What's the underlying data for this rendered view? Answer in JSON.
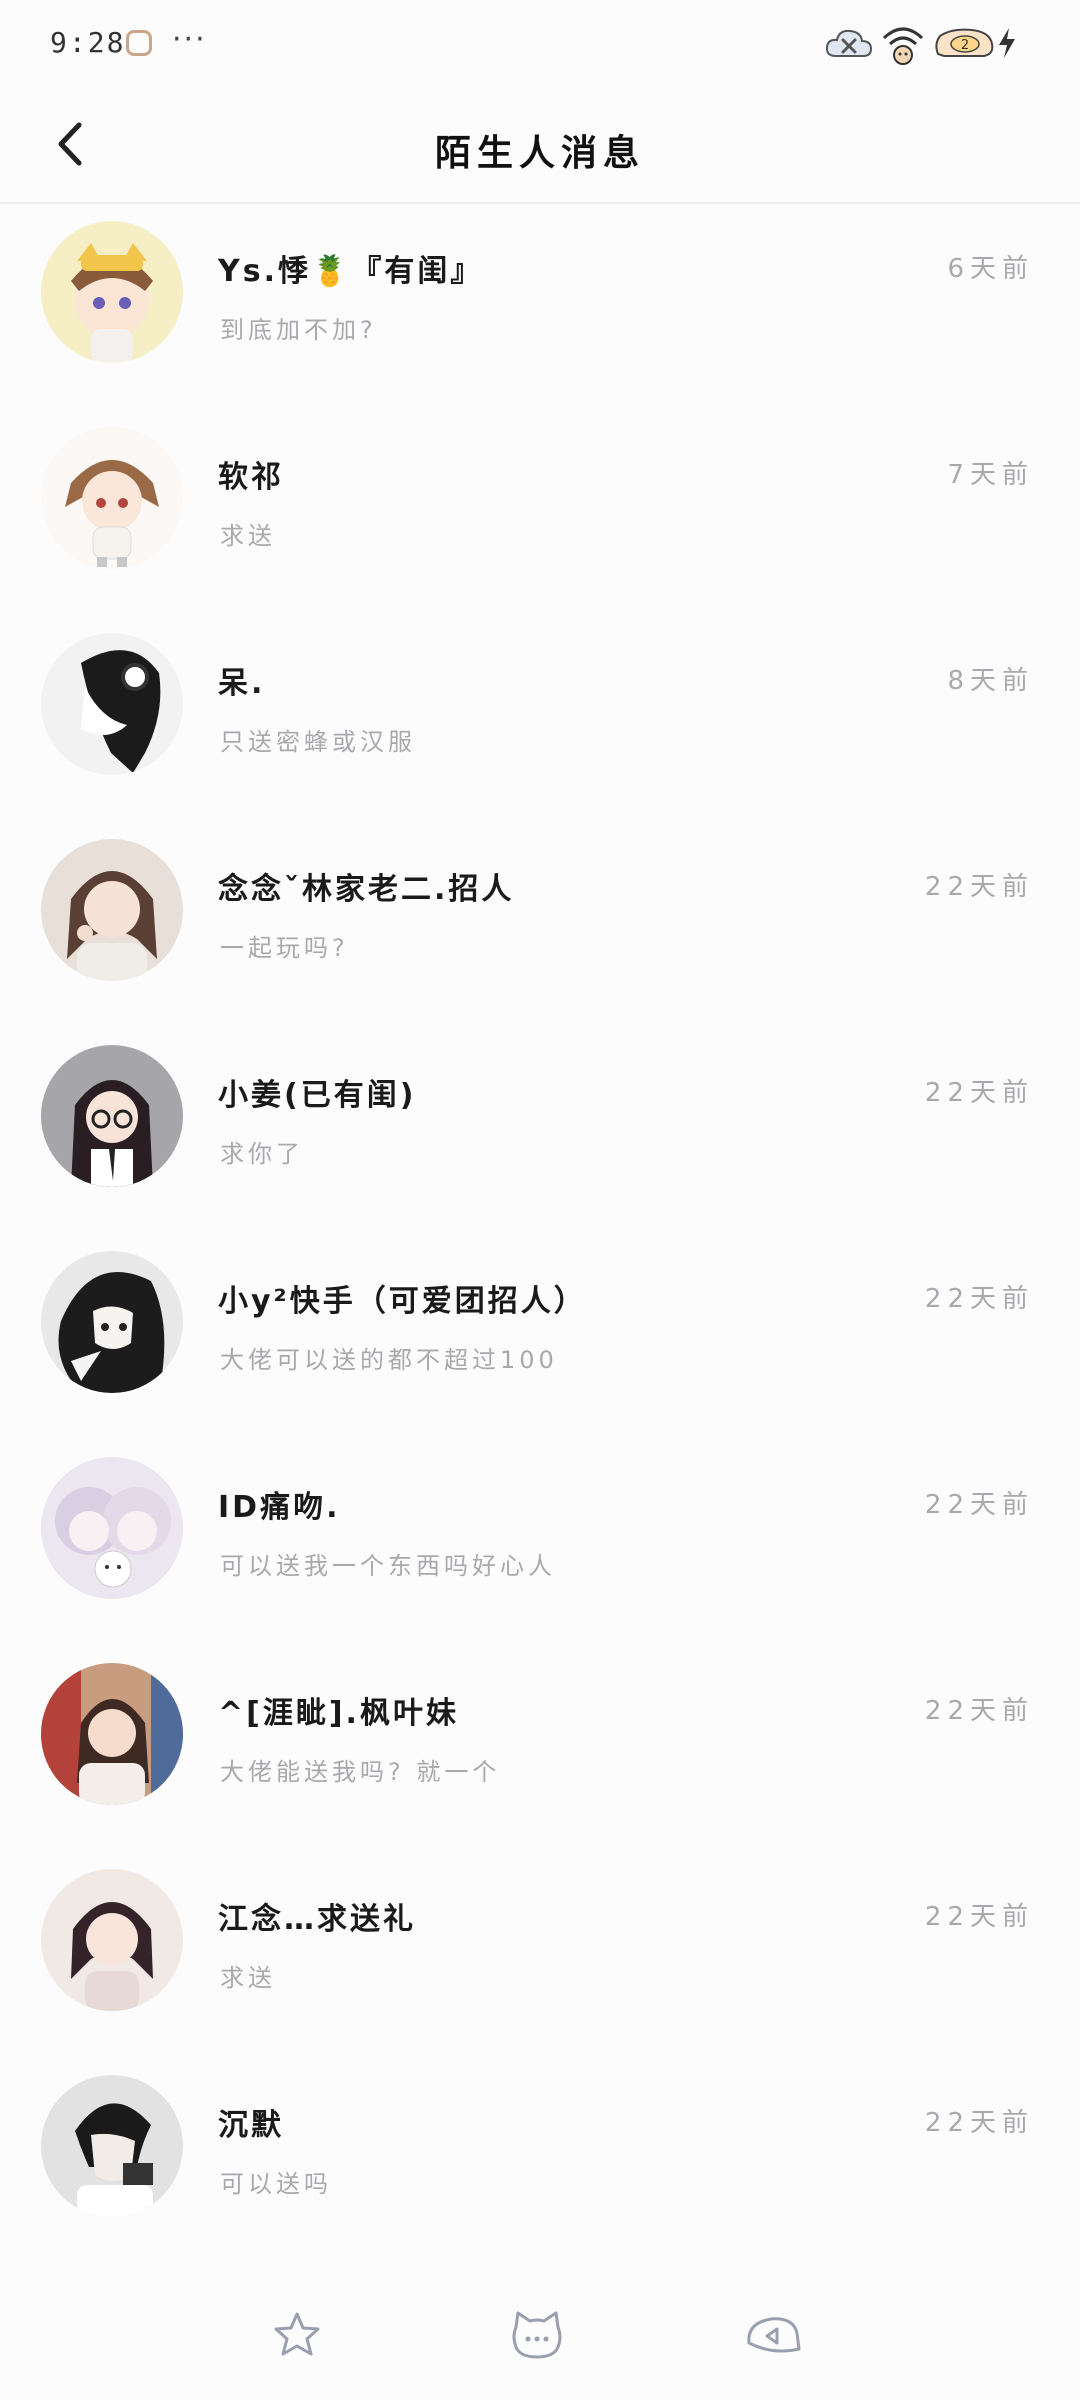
{
  "status_bar": {
    "time": "9:28",
    "more": "···",
    "battery_level": "2"
  },
  "header": {
    "title": "陌生人消息"
  },
  "messages": [
    {
      "name": "Ys.悸🍍『有闺』",
      "preview": "到底加不加?",
      "time": "6天前",
      "avatar_color": "#f4e7c0"
    },
    {
      "name": "软祁",
      "preview": "求送",
      "time": "7天前",
      "avatar_color": "#f5efe8"
    },
    {
      "name": "呆.",
      "preview": "只送密蜂或汉服",
      "time": "8天前",
      "avatar_color": "#e9e9e9"
    },
    {
      "name": "念念ˇ林家老二.招人",
      "preview": "一起玩吗?",
      "time": "22天前",
      "avatar_color": "#e8ddd6"
    },
    {
      "name": "小姜(已有闺)",
      "preview": "求你了",
      "time": "22天前",
      "avatar_color": "#a9a9ad"
    },
    {
      "name": "小y²快手（可爱团招人）",
      "preview": "大佬可以送的都不超过100",
      "time": "22天前",
      "avatar_color": "#d9d9d9"
    },
    {
      "name": "ID痛吻.",
      "preview": "可以送我一个东西吗好心人",
      "time": "22天前",
      "avatar_color": "#e6e0ee"
    },
    {
      "name": "^[涯眦].枫叶妹",
      "preview": "大佬能送我吗? 就一个",
      "time": "22天前",
      "avatar_color": "#d8c0b0"
    },
    {
      "name": "江念…求送礼",
      "preview": "求送",
      "time": "22天前",
      "avatar_color": "#efe3dc"
    },
    {
      "name": "沉默",
      "preview": "可以送吗",
      "time": "22天前",
      "avatar_color": "#e4e4e4"
    }
  ],
  "bottom_nav": {
    "items": [
      "star-icon",
      "cat-face-icon",
      "speaker-icon"
    ]
  },
  "colors": {
    "background": "#fdfcfd",
    "name": "#1a1a1a",
    "secondary": "#a9a9ad"
  }
}
